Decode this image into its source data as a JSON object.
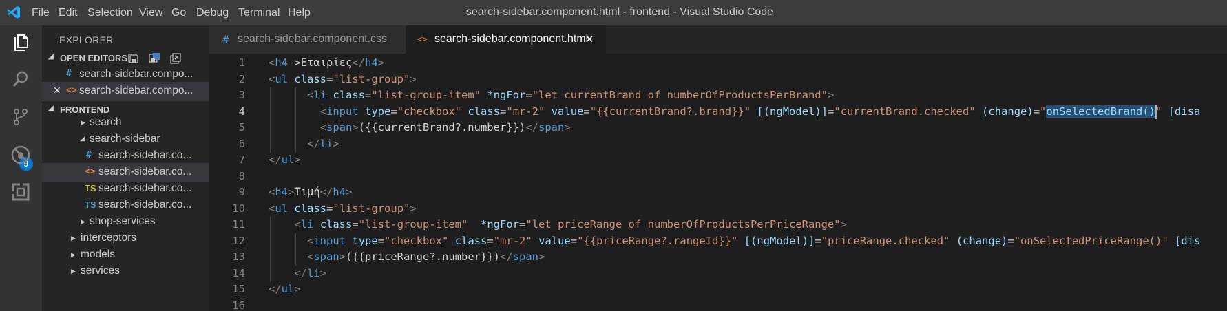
{
  "window_title": "search-sidebar.component.html - frontend - Visual Studio Code",
  "menu": [
    "File",
    "Edit",
    "Selection",
    "View",
    "Go",
    "Debug",
    "Terminal",
    "Help"
  ],
  "activity": {
    "scm_badge": "9"
  },
  "explorer": {
    "title": "EXPLORER",
    "open_editors": {
      "label": "OPEN EDITORS",
      "items": [
        {
          "label": "search-sidebar.compo..."
        },
        {
          "label": "search-sidebar.compo...",
          "close": "✕"
        }
      ]
    },
    "frontend": {
      "label": "FRONTEND",
      "tree": [
        {
          "label": "search"
        },
        {
          "label": "search-sidebar"
        },
        {
          "label": "search-sidebar.co..."
        },
        {
          "label": "search-sidebar.co..."
        },
        {
          "label": "search-sidebar.co...",
          "icon": "TS"
        },
        {
          "label": "search-sidebar.co...",
          "icon": "TS"
        },
        {
          "label": "shop-services"
        },
        {
          "label": "interceptors"
        },
        {
          "label": "models"
        },
        {
          "label": "services"
        }
      ]
    }
  },
  "tabs": [
    {
      "label": "search-sidebar.component.css",
      "active": false
    },
    {
      "label": "search-sidebar.component.html",
      "active": true,
      "close": "✕"
    }
  ],
  "editor": {
    "current_line": 4,
    "line_numbers": [
      "1",
      "2",
      "3",
      "4",
      "5",
      "6",
      "7",
      "8",
      "9",
      "10",
      "11",
      "12",
      "13",
      "14",
      "15",
      "16"
    ],
    "lines": [
      {
        "tokens": [
          [
            "t",
            "<"
          ],
          [
            "tn",
            "h4"
          ],
          [
            "tx",
            " >"
          ],
          [
            "tx",
            "Εταιρίες"
          ],
          [
            "t",
            "</"
          ],
          [
            "tn",
            "h4"
          ],
          [
            "t",
            ">"
          ]
        ]
      },
      {
        "tokens": [
          [
            "t",
            "<"
          ],
          [
            "tn",
            "ul"
          ],
          [
            "tx",
            " "
          ],
          [
            "an",
            "class"
          ],
          [
            "tx",
            "="
          ],
          [
            "av",
            "\"list-group\""
          ],
          [
            "t",
            ">"
          ]
        ]
      },
      {
        "tokens": [
          [
            "tx",
            "      "
          ],
          [
            "t",
            "<"
          ],
          [
            "tn",
            "li"
          ],
          [
            "tx",
            " "
          ],
          [
            "an",
            "class"
          ],
          [
            "tx",
            "="
          ],
          [
            "av",
            "\"list-group-item\""
          ],
          [
            "tx",
            " "
          ],
          [
            "an",
            "*ngFor"
          ],
          [
            "tx",
            "="
          ],
          [
            "av",
            "\"let currentBrand of numberOfProductsPerBrand\""
          ],
          [
            "t",
            ">"
          ]
        ]
      },
      {
        "tokens": [
          [
            "tx",
            "        "
          ],
          [
            "t",
            "<"
          ],
          [
            "tn",
            "input"
          ],
          [
            "tx",
            " "
          ],
          [
            "an",
            "type"
          ],
          [
            "tx",
            "="
          ],
          [
            "av",
            "\"checkbox\""
          ],
          [
            "tx",
            " "
          ],
          [
            "an",
            "class"
          ],
          [
            "tx",
            "="
          ],
          [
            "av",
            "\"mr-2\""
          ],
          [
            "tx",
            " "
          ],
          [
            "an",
            "value"
          ],
          [
            "tx",
            "="
          ],
          [
            "av",
            "\"{{currentBrand?.brand}}\""
          ],
          [
            "tx",
            " "
          ],
          [
            "an",
            "[(ngModel)]"
          ],
          [
            "tx",
            "="
          ],
          [
            "av",
            "\"currentBrand.checked\""
          ],
          [
            "tx",
            " "
          ],
          [
            "an",
            "(change)"
          ],
          [
            "tx",
            "="
          ],
          [
            "av",
            "\""
          ],
          [
            "hl",
            "onSelectedBrand()"
          ],
          [
            "av",
            "\""
          ],
          [
            "tx",
            " "
          ],
          [
            "an",
            "[disa"
          ]
        ]
      },
      {
        "tokens": [
          [
            "tx",
            "        "
          ],
          [
            "t",
            "<"
          ],
          [
            "tn",
            "span"
          ],
          [
            "t",
            ">"
          ],
          [
            "tx",
            "({{currentBrand?.number}})"
          ],
          [
            "t",
            "</"
          ],
          [
            "tn",
            "span"
          ],
          [
            "t",
            ">"
          ]
        ]
      },
      {
        "tokens": [
          [
            "tx",
            "      "
          ],
          [
            "t",
            "</"
          ],
          [
            "tn",
            "li"
          ],
          [
            "t",
            ">"
          ]
        ]
      },
      {
        "tokens": [
          [
            "t",
            "</"
          ],
          [
            "tn",
            "ul"
          ],
          [
            "t",
            ">"
          ]
        ]
      },
      {
        "tokens": []
      },
      {
        "tokens": [
          [
            "t",
            "<"
          ],
          [
            "tn",
            "h4"
          ],
          [
            "t",
            ">"
          ],
          [
            "tx",
            "Τιμή"
          ],
          [
            "t",
            "</"
          ],
          [
            "tn",
            "h4"
          ],
          [
            "t",
            ">"
          ]
        ]
      },
      {
        "tokens": [
          [
            "t",
            "<"
          ],
          [
            "tn",
            "ul"
          ],
          [
            "tx",
            " "
          ],
          [
            "an",
            "class"
          ],
          [
            "tx",
            "="
          ],
          [
            "av",
            "\"list-group\""
          ],
          [
            "t",
            ">"
          ]
        ]
      },
      {
        "tokens": [
          [
            "tx",
            "    "
          ],
          [
            "t",
            "<"
          ],
          [
            "tn",
            "li"
          ],
          [
            "tx",
            " "
          ],
          [
            "an",
            "class"
          ],
          [
            "tx",
            "="
          ],
          [
            "av",
            "\"list-group-item\""
          ],
          [
            "tx",
            "  "
          ],
          [
            "an",
            "*ngFor"
          ],
          [
            "tx",
            "="
          ],
          [
            "av",
            "\"let priceRange of numberOfProductsPerPriceRange\""
          ],
          [
            "t",
            ">"
          ]
        ]
      },
      {
        "tokens": [
          [
            "tx",
            "      "
          ],
          [
            "t",
            "<"
          ],
          [
            "tn",
            "input"
          ],
          [
            "tx",
            " "
          ],
          [
            "an",
            "type"
          ],
          [
            "tx",
            "="
          ],
          [
            "av",
            "\"checkbox\""
          ],
          [
            "tx",
            " "
          ],
          [
            "an",
            "class"
          ],
          [
            "tx",
            "="
          ],
          [
            "av",
            "\"mr-2\""
          ],
          [
            "tx",
            " "
          ],
          [
            "an",
            "value"
          ],
          [
            "tx",
            "="
          ],
          [
            "av",
            "\"{{priceRange?.rangeId}}\""
          ],
          [
            "tx",
            " "
          ],
          [
            "an",
            "[(ngModel)]"
          ],
          [
            "tx",
            "="
          ],
          [
            "av",
            "\"priceRange.checked\""
          ],
          [
            "tx",
            " "
          ],
          [
            "an",
            "(change)"
          ],
          [
            "tx",
            "="
          ],
          [
            "av",
            "\"onSelectedPriceRange()\""
          ],
          [
            "tx",
            " "
          ],
          [
            "an",
            "[dis"
          ]
        ]
      },
      {
        "tokens": [
          [
            "tx",
            "      "
          ],
          [
            "t",
            "<"
          ],
          [
            "tn",
            "span"
          ],
          [
            "t",
            ">"
          ],
          [
            "tx",
            "({{priceRange?.number}})"
          ],
          [
            "t",
            "</"
          ],
          [
            "tn",
            "span"
          ],
          [
            "t",
            ">"
          ]
        ]
      },
      {
        "tokens": [
          [
            "tx",
            "    "
          ],
          [
            "t",
            "</"
          ],
          [
            "tn",
            "li"
          ],
          [
            "t",
            ">"
          ]
        ]
      },
      {
        "tokens": [
          [
            "t",
            "</"
          ],
          [
            "tn",
            "ul"
          ],
          [
            "t",
            ">"
          ]
        ]
      },
      {
        "tokens": []
      }
    ]
  },
  "colors": {
    "accent": "#007acc",
    "titlebar": "#3c3c3c",
    "editor_bg": "#1e1e1e",
    "sidebar_bg": "#252526",
    "activitybar_bg": "#333333"
  }
}
